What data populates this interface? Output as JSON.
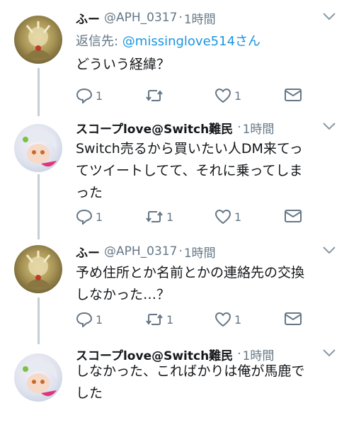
{
  "tweets": [
    {
      "name": "ふー",
      "handle": "@APH_0317",
      "dot": "·",
      "time": "1時間",
      "reply_prefix": "返信先: ",
      "reply_mention": "@missinglove514",
      "reply_suffix": "さん",
      "lines": [
        "どういう経緯？"
      ],
      "reply_count": "1",
      "retweet_count": "",
      "like_count": "1"
    },
    {
      "name": "スコープlove@Switch難民",
      "handle": "",
      "dot": "·",
      "time": "1時間",
      "lines": [
        "Switch売るから買いたい人DM来てっ",
        "てツイートしてて、それに乗ってしま",
        "った"
      ],
      "reply_count": "1",
      "retweet_count": "1",
      "like_count": "1"
    },
    {
      "name": "ふー",
      "handle": "@APH_0317",
      "dot": "·",
      "time": "1時間",
      "lines": [
        "予め住所とか名前とかの連絡先の交換",
        "しなかった…？"
      ],
      "reply_count": "1",
      "retweet_count": "1",
      "like_count": "1"
    },
    {
      "name": "スコープlove@Switch難民",
      "handle": "",
      "dot": "·",
      "time": "1時間",
      "lines": [
        "しなかった、こればかりは俺が馬鹿で",
        "した"
      ]
    }
  ],
  "colors": {
    "text": "#14171a",
    "muted": "#657786",
    "link": "#1b95e0",
    "thread_line": "#c4cfd6"
  }
}
